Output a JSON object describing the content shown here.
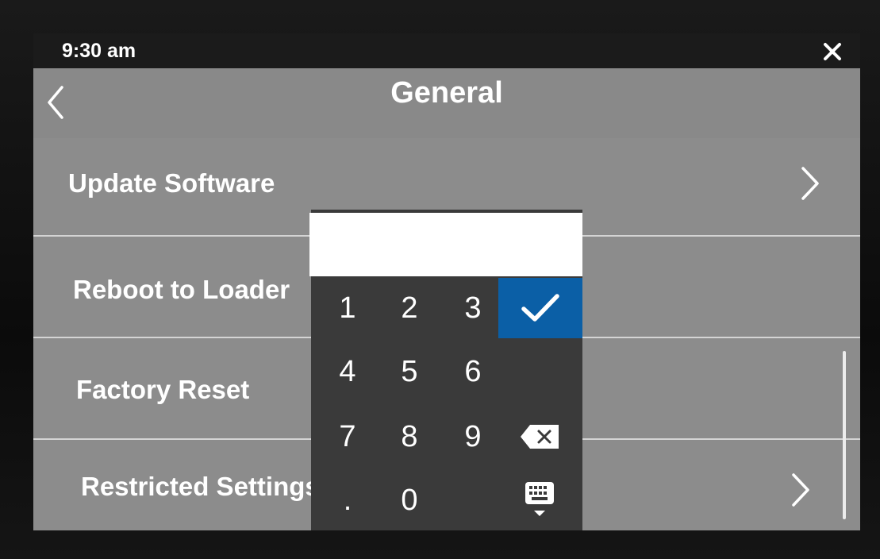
{
  "status_bar": {
    "time": "9:30 am",
    "close_icon": "close-icon"
  },
  "header": {
    "title": "General",
    "back_icon": "chevron-left-icon"
  },
  "menu": {
    "items": [
      {
        "label": "Update Software",
        "has_chevron": true
      },
      {
        "label": "Reboot to Loader",
        "has_chevron": false
      },
      {
        "label": "Factory Reset",
        "has_chevron": false
      },
      {
        "label": "Restricted Settings",
        "has_chevron": true
      }
    ]
  },
  "keypad": {
    "input_value": "",
    "keys": {
      "one": "1",
      "two": "2",
      "three": "3",
      "four": "4",
      "five": "5",
      "six": "6",
      "seven": "7",
      "eight": "8",
      "nine": "9",
      "dot": ".",
      "zero": "0"
    },
    "enter_icon": "checkmark-icon",
    "backspace_icon": "backspace-icon",
    "hide_keyboard_icon": "keyboard-hide-icon",
    "enter_color": "#0b5fa6"
  },
  "colors": {
    "screen_bg": "#8c8c8c",
    "status_bar": "#1b1b1b",
    "keypad_bg": "#3a3a3a"
  }
}
